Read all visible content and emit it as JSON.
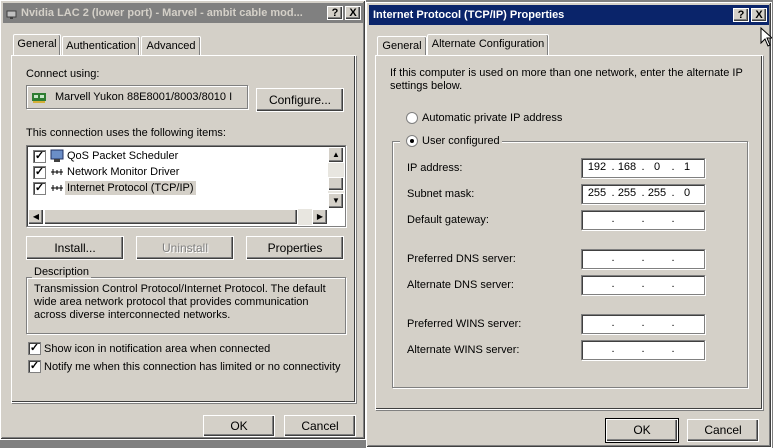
{
  "left_dialog": {
    "title": "Nvidia LAC 2 (lower port) - Marvel - ambit cable mod...",
    "help_btn": "?",
    "close_btn": "X",
    "tabs": [
      {
        "label": "General",
        "selected": true
      },
      {
        "label": "Authentication",
        "selected": false
      },
      {
        "label": "Advanced",
        "selected": false
      }
    ],
    "connect_using_label": "Connect using:",
    "adapter_name": "Marvell Yukon 88E8001/8003/8010 I",
    "configure_label": "Configure...",
    "items_label": "This connection uses the following items:",
    "items": [
      {
        "label": "QoS Packet Scheduler",
        "checked": true,
        "icon": "scheduler-icon"
      },
      {
        "label": "Network Monitor Driver",
        "checked": true,
        "icon": "protocol-icon"
      },
      {
        "label": "Internet Protocol (TCP/IP)",
        "checked": true,
        "icon": "protocol-icon"
      }
    ],
    "install_label": "Install...",
    "uninstall_label": "Uninstall",
    "properties_label": "Properties",
    "description_title": "Description",
    "description_text": "Transmission Control Protocol/Internet Protocol. The default wide area network protocol that provides communication across diverse interconnected networks.",
    "show_icon_label": "Show icon in notification area when connected",
    "notify_label": "Notify me when this connection has limited or no connectivity",
    "ok_label": "OK",
    "cancel_label": "Cancel"
  },
  "right_dialog": {
    "title": "Internet Protocol (TCP/IP) Properties",
    "help_btn": "?",
    "close_btn": "X",
    "tabs": [
      {
        "label": "General",
        "selected": false
      },
      {
        "label": "Alternate Configuration",
        "selected": true
      }
    ],
    "intro_text": "If this computer is used on more than one network, enter the alternate IP settings below.",
    "auto_private_label": "Automatic private IP address",
    "user_configured_label": "User configured",
    "fields": [
      {
        "label": "IP address:",
        "octets": [
          "192",
          "168",
          "0",
          "1"
        ]
      },
      {
        "label": "Subnet mask:",
        "octets": [
          "255",
          "255",
          "255",
          "0"
        ]
      },
      {
        "label": "Default gateway:",
        "octets": [
          "",
          "",
          "",
          ""
        ]
      },
      {
        "label": "Preferred DNS server:",
        "octets": [
          "",
          "",
          "",
          ""
        ]
      },
      {
        "label": "Alternate DNS server:",
        "octets": [
          "",
          "",
          "",
          ""
        ]
      },
      {
        "label": "Preferred WINS server:",
        "octets": [
          "",
          "",
          "",
          ""
        ]
      },
      {
        "label": "Alternate WINS server:",
        "octets": [
          "",
          "",
          "",
          ""
        ]
      }
    ],
    "ok_label": "OK",
    "cancel_label": "Cancel"
  },
  "colors": {
    "active_title": "#0a246a",
    "inactive_title": "#808080",
    "face": "#d4d0c8"
  }
}
